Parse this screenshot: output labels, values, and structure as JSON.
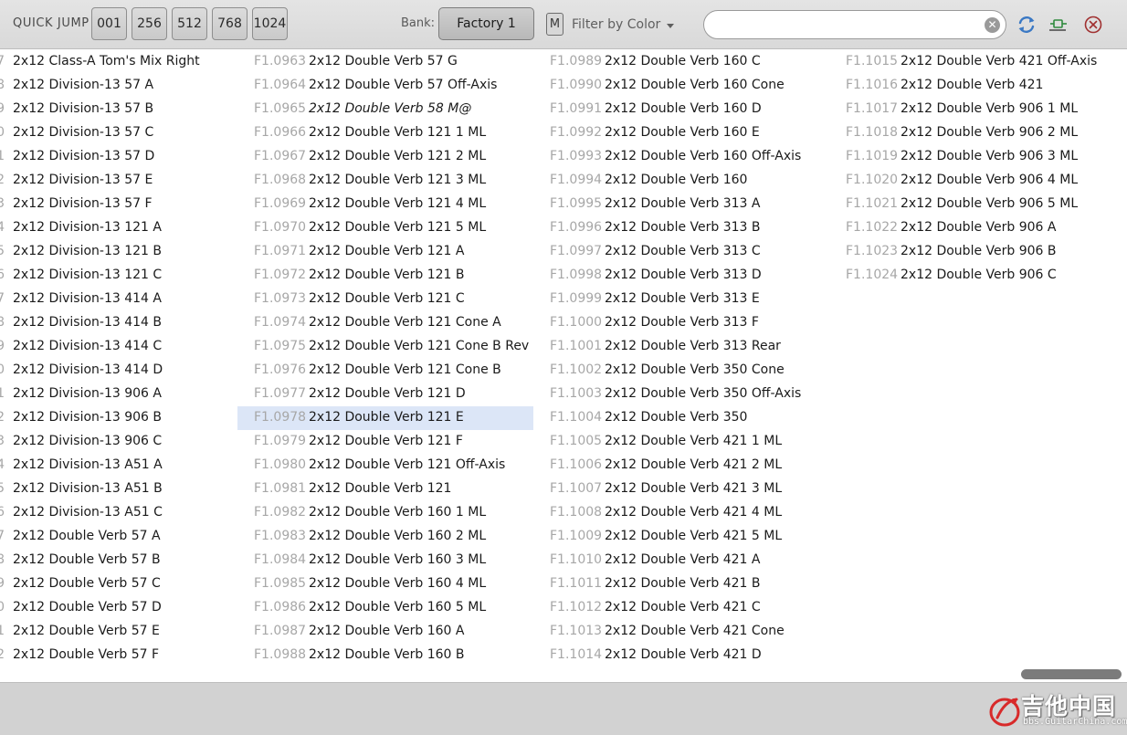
{
  "toolbar": {
    "quick_jump_label": "QUICK JUMP",
    "jump_buttons": [
      "001",
      "256",
      "512",
      "768",
      "1024"
    ],
    "bank_label": "Bank:",
    "bank_value": "Factory 1",
    "m_button_label": "M",
    "filter_color_label": "Filter by Color",
    "search_value": "",
    "search_placeholder": "",
    "icons": [
      "clear-search-icon",
      "refresh-icon",
      "cable-icon",
      "close-icon"
    ],
    "accent_color": "#3a78c4"
  },
  "list": {
    "selected_number": "F1.0978",
    "selected_color": "#dce6f7",
    "columns": [
      {
        "items": [
          {
            "number": "7",
            "name": "2x12 Class-A Tom's Mix Right"
          },
          {
            "number": "8",
            "name": "2x12 Division-13 57 A"
          },
          {
            "number": "9",
            "name": "2x12 Division-13 57 B"
          },
          {
            "number": "0",
            "name": "2x12 Division-13 57 C"
          },
          {
            "number": "1",
            "name": "2x12 Division-13 57 D"
          },
          {
            "number": "2",
            "name": "2x12 Division-13 57 E"
          },
          {
            "number": "3",
            "name": "2x12 Division-13 57 F"
          },
          {
            "number": "4",
            "name": "2x12 Division-13 121 A"
          },
          {
            "number": "5",
            "name": "2x12 Division-13 121 B"
          },
          {
            "number": "6",
            "name": "2x12 Division-13 121 C"
          },
          {
            "number": "7",
            "name": "2x12 Division-13 414 A"
          },
          {
            "number": "8",
            "name": "2x12 Division-13 414 B"
          },
          {
            "number": "9",
            "name": "2x12 Division-13 414 C"
          },
          {
            "number": "0",
            "name": "2x12 Division-13 414 D"
          },
          {
            "number": "1",
            "name": "2x12 Division-13 906 A"
          },
          {
            "number": "2",
            "name": "2x12 Division-13 906 B"
          },
          {
            "number": "3",
            "name": "2x12 Division-13 906 C"
          },
          {
            "number": "4",
            "name": "2x12 Division-13 A51 A"
          },
          {
            "number": "5",
            "name": "2x12 Division-13 A51 B"
          },
          {
            "number": "6",
            "name": "2x12 Division-13 A51 C"
          },
          {
            "number": "7",
            "name": "2x12 Double Verb 57 A"
          },
          {
            "number": "8",
            "name": "2x12 Double Verb 57 B"
          },
          {
            "number": "9",
            "name": "2x12 Double Verb 57 C"
          },
          {
            "number": "0",
            "name": "2x12 Double Verb 57 D"
          },
          {
            "number": "1",
            "name": "2x12 Double Verb 57 E"
          },
          {
            "number": "2",
            "name": "2x12 Double Verb 57 F"
          }
        ]
      },
      {
        "items": [
          {
            "number": "F1.0963",
            "name": "2x12 Double Verb 57 G"
          },
          {
            "number": "F1.0964",
            "name": "2x12 Double Verb 57 Off-Axis"
          },
          {
            "number": "F1.0965",
            "name": "2x12 Double Verb 58 M@",
            "italic": true
          },
          {
            "number": "F1.0966",
            "name": "2x12 Double Verb 121 1 ML"
          },
          {
            "number": "F1.0967",
            "name": "2x12 Double Verb 121 2 ML"
          },
          {
            "number": "F1.0968",
            "name": "2x12 Double Verb 121 3 ML"
          },
          {
            "number": "F1.0969",
            "name": "2x12 Double Verb 121 4 ML"
          },
          {
            "number": "F1.0970",
            "name": "2x12 Double Verb 121 5 ML"
          },
          {
            "number": "F1.0971",
            "name": "2x12 Double Verb 121 A"
          },
          {
            "number": "F1.0972",
            "name": "2x12 Double Verb 121 B"
          },
          {
            "number": "F1.0973",
            "name": "2x12 Double Verb 121 C"
          },
          {
            "number": "F1.0974",
            "name": "2x12 Double Verb 121 Cone A"
          },
          {
            "number": "F1.0975",
            "name": "2x12 Double Verb 121 Cone B Rev"
          },
          {
            "number": "F1.0976",
            "name": "2x12 Double Verb 121 Cone B"
          },
          {
            "number": "F1.0977",
            "name": "2x12 Double Verb 121 D"
          },
          {
            "number": "F1.0978",
            "name": "2x12 Double Verb 121 E"
          },
          {
            "number": "F1.0979",
            "name": "2x12 Double Verb 121 F"
          },
          {
            "number": "F1.0980",
            "name": "2x12 Double Verb 121 Off-Axis"
          },
          {
            "number": "F1.0981",
            "name": "2x12 Double Verb 121"
          },
          {
            "number": "F1.0982",
            "name": "2x12 Double Verb 160 1 ML"
          },
          {
            "number": "F1.0983",
            "name": "2x12 Double Verb 160 2 ML"
          },
          {
            "number": "F1.0984",
            "name": "2x12 Double Verb 160 3 ML"
          },
          {
            "number": "F1.0985",
            "name": "2x12 Double Verb 160 4 ML"
          },
          {
            "number": "F1.0986",
            "name": "2x12 Double Verb 160 5 ML"
          },
          {
            "number": "F1.0987",
            "name": "2x12 Double Verb 160 A"
          },
          {
            "number": "F1.0988",
            "name": "2x12 Double Verb 160 B"
          }
        ]
      },
      {
        "items": [
          {
            "number": "F1.0989",
            "name": "2x12 Double Verb 160 C"
          },
          {
            "number": "F1.0990",
            "name": "2x12 Double Verb 160 Cone"
          },
          {
            "number": "F1.0991",
            "name": "2x12 Double Verb 160 D"
          },
          {
            "number": "F1.0992",
            "name": "2x12 Double Verb 160 E"
          },
          {
            "number": "F1.0993",
            "name": "2x12 Double Verb 160 Off-Axis"
          },
          {
            "number": "F1.0994",
            "name": "2x12 Double Verb 160"
          },
          {
            "number": "F1.0995",
            "name": "2x12 Double Verb 313 A"
          },
          {
            "number": "F1.0996",
            "name": "2x12 Double Verb 313 B"
          },
          {
            "number": "F1.0997",
            "name": "2x12 Double Verb 313 C"
          },
          {
            "number": "F1.0998",
            "name": "2x12 Double Verb 313 D"
          },
          {
            "number": "F1.0999",
            "name": "2x12 Double Verb 313 E"
          },
          {
            "number": "F1.1000",
            "name": "2x12 Double Verb 313 F"
          },
          {
            "number": "F1.1001",
            "name": "2x12 Double Verb 313 Rear"
          },
          {
            "number": "F1.1002",
            "name": "2x12 Double Verb 350 Cone"
          },
          {
            "number": "F1.1003",
            "name": "2x12 Double Verb 350 Off-Axis"
          },
          {
            "number": "F1.1004",
            "name": "2x12 Double Verb 350"
          },
          {
            "number": "F1.1005",
            "name": "2x12 Double Verb 421 1 ML"
          },
          {
            "number": "F1.1006",
            "name": "2x12 Double Verb 421 2 ML"
          },
          {
            "number": "F1.1007",
            "name": "2x12 Double Verb 421 3 ML"
          },
          {
            "number": "F1.1008",
            "name": "2x12 Double Verb 421 4 ML"
          },
          {
            "number": "F1.1009",
            "name": "2x12 Double Verb 421 5 ML"
          },
          {
            "number": "F1.1010",
            "name": "2x12 Double Verb 421 A"
          },
          {
            "number": "F1.1011",
            "name": "2x12 Double Verb 421 B"
          },
          {
            "number": "F1.1012",
            "name": "2x12 Double Verb 421 C"
          },
          {
            "number": "F1.1013",
            "name": "2x12 Double Verb 421 Cone"
          },
          {
            "number": "F1.1014",
            "name": "2x12 Double Verb 421 D"
          }
        ]
      },
      {
        "items": [
          {
            "number": "F1.1015",
            "name": "2x12 Double Verb 421 Off-Axis"
          },
          {
            "number": "F1.1016",
            "name": "2x12 Double Verb 421"
          },
          {
            "number": "F1.1017",
            "name": "2x12 Double Verb 906 1 ML"
          },
          {
            "number": "F1.1018",
            "name": "2x12 Double Verb 906 2 ML"
          },
          {
            "number": "F1.1019",
            "name": "2x12 Double Verb 906 3 ML"
          },
          {
            "number": "F1.1020",
            "name": "2x12 Double Verb 906 4 ML"
          },
          {
            "number": "F1.1021",
            "name": "2x12 Double Verb 906 5 ML"
          },
          {
            "number": "F1.1022",
            "name": "2x12 Double Verb 906 A"
          },
          {
            "number": "F1.1023",
            "name": "2x12 Double Verb 906 B"
          },
          {
            "number": "F1.1024",
            "name": "2x12 Double Verb 906 C"
          }
        ]
      }
    ]
  },
  "watermark": {
    "logo_text": "吉他中国",
    "url_text": "bbs.GuitarChina.com"
  }
}
